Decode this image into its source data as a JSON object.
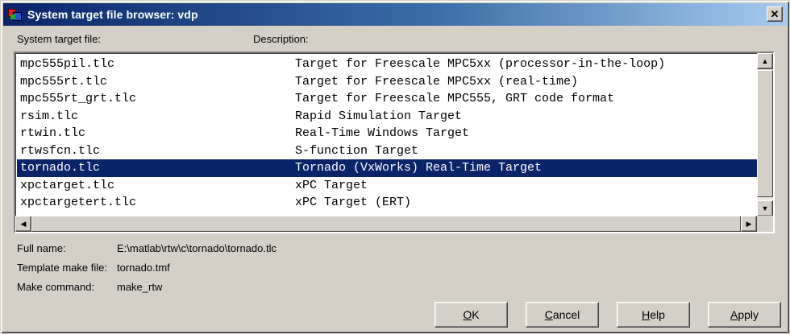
{
  "window": {
    "title": "System target file browser: vdp",
    "close_glyph": "✕"
  },
  "columns": {
    "file": "System target file:",
    "description": "Description:"
  },
  "rows": [
    {
      "file": "mpc555pil.tlc",
      "description": "Target for Freescale MPC5xx (processor-in-the-loop)"
    },
    {
      "file": "mpc555rt.tlc",
      "description": "Target for Freescale MPC5xx (real-time)"
    },
    {
      "file": "mpc555rt_grt.tlc",
      "description": "Target for Freescale MPC555, GRT code format"
    },
    {
      "file": "rsim.tlc",
      "description": "Rapid Simulation Target"
    },
    {
      "file": "rtwin.tlc",
      "description": "Real-Time Windows Target"
    },
    {
      "file": "rtwsfcn.tlc",
      "description": "S-function Target"
    },
    {
      "file": "tornado.tlc",
      "description": "Tornado (VxWorks) Real-Time Target",
      "selected": true
    },
    {
      "file": "xpctarget.tlc",
      "description": "xPC Target"
    },
    {
      "file": "xpctargetert.tlc",
      "description": "xPC Target (ERT)"
    }
  ],
  "details": {
    "full_name_label": "Full name:",
    "full_name_value": "E:\\matlab\\rtw\\c\\tornado\\tornado.tlc",
    "template_label": "Template make file:",
    "template_value": "tornado.tmf",
    "make_label": "Make command:",
    "make_value": "make_rtw"
  },
  "buttons": {
    "ok_mnemonic": "O",
    "ok_rest": "K",
    "cancel_mnemonic": "C",
    "cancel_rest": "ancel",
    "help_mnemonic": "H",
    "help_rest": "elp",
    "apply_mnemonic": "A",
    "apply_rest": "pply"
  },
  "scrollbar": {
    "up_glyph": "▲",
    "down_glyph": "▼",
    "left_glyph": "◀",
    "right_glyph": "▶"
  },
  "colors": {
    "selection": "#0a246a",
    "title_gradient_start": "#0a246a",
    "face": "#d4d0c8"
  }
}
